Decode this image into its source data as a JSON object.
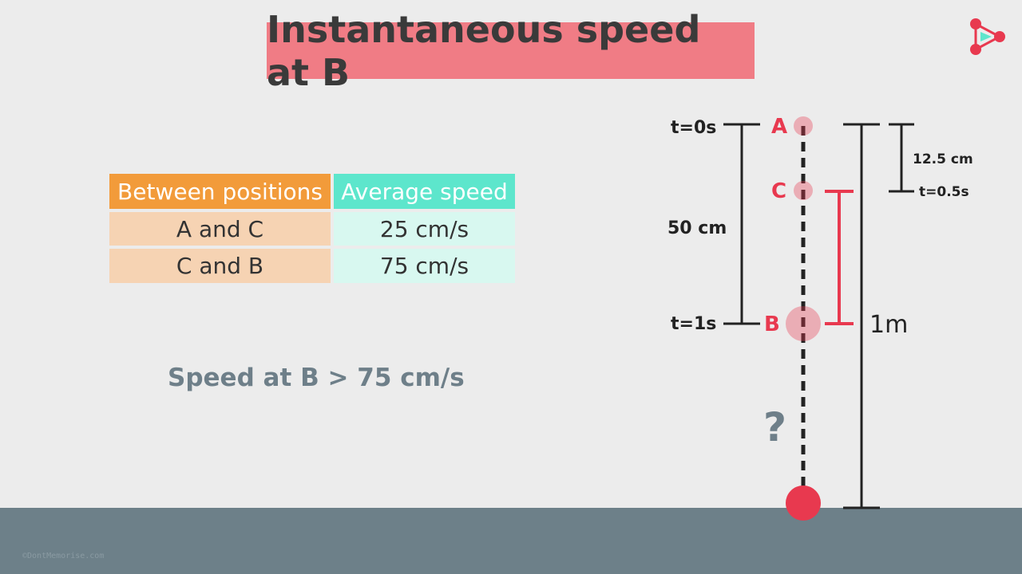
{
  "title": "Instantaneous speed at B",
  "table": {
    "headers": [
      "Between positions",
      "Average speed"
    ],
    "rows": [
      [
        "A and C",
        "25 cm/s"
      ],
      [
        "C and B",
        "75 cm/s"
      ]
    ]
  },
  "note": "Speed at B > 75 cm/s",
  "diagram": {
    "points": {
      "a": "A",
      "c": "C",
      "b": "B"
    },
    "times": {
      "t0": "t=0s",
      "t1": "t=1s",
      "t05": "t=0.5s"
    },
    "distances": {
      "d50": "50 cm",
      "d125": "12.5 cm",
      "d1m": "1m"
    },
    "question": "?"
  },
  "watermark": "©DontMemorise.com",
  "colors": {
    "title_bg": "#f07c85",
    "header_left": "#f29b3a",
    "header_right": "#5de6cc",
    "ball_red": "#e8394f",
    "ground": "#6d8089"
  },
  "logo_icon": "play-triangle-logo-icon"
}
